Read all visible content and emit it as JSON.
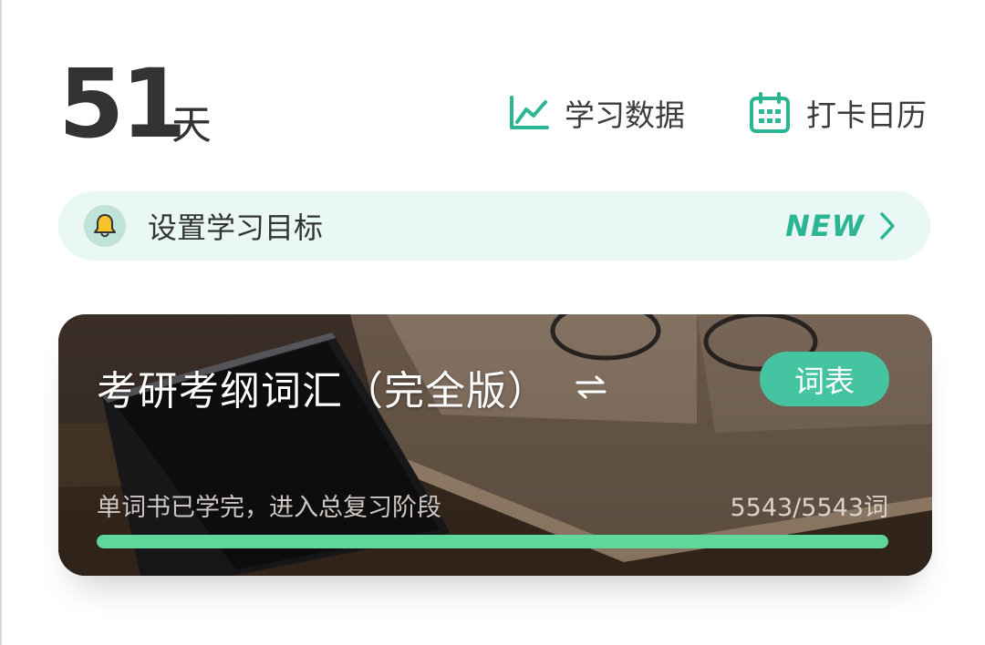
{
  "streak": {
    "days": "51",
    "unit": "天"
  },
  "header": {
    "stats_label": "学习数据",
    "calendar_label": "打卡日历"
  },
  "goal_banner": {
    "label": "设置学习目标",
    "badge": "NEW"
  },
  "book": {
    "title": "考研考纲词汇（完全版）",
    "wordlist_button": "词表",
    "status_text": "单词书已学完，进入总复习阶段",
    "count_text": "5543/5543词",
    "progress": 1.0
  },
  "colors": {
    "accent": "#2cb593",
    "banner_bg": "#e9f8f4",
    "button": "#45c4a2",
    "progress": "#5fd69a"
  },
  "icons": {
    "stats": "line-chart-icon",
    "calendar": "calendar-icon",
    "bell": "bell-icon",
    "chevron": "chevron-right-icon",
    "switch": "switch-arrows-icon"
  }
}
